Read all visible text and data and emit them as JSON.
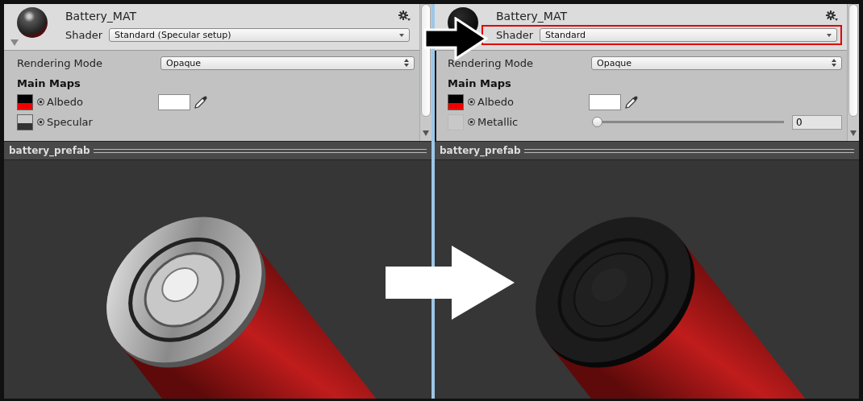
{
  "panels": [
    {
      "material_name": "Battery_MAT",
      "metallic": true,
      "shader_label": "Shader",
      "shader": "Standard (Specular setup)",
      "highlighted": false,
      "rendering_mode_label": "Rendering Mode",
      "rendering_mode": "Opaque",
      "section": "Main Maps",
      "properties": [
        {
          "kind": "color",
          "label": "Albedo"
        },
        {
          "kind": "texture",
          "label": "Specular"
        }
      ],
      "preview_title": "battery_prefab"
    },
    {
      "material_name": "Battery_MAT",
      "metallic": false,
      "shader_label": "Shader",
      "shader": "Standard",
      "highlighted": true,
      "rendering_mode_label": "Rendering Mode",
      "rendering_mode": "Opaque",
      "section": "Main Maps",
      "properties": [
        {
          "kind": "color",
          "label": "Albedo"
        },
        {
          "kind": "slider",
          "label": "Metallic",
          "level": 0,
          "reading": "0"
        }
      ],
      "preview_title": "battery_prefab"
    }
  ]
}
